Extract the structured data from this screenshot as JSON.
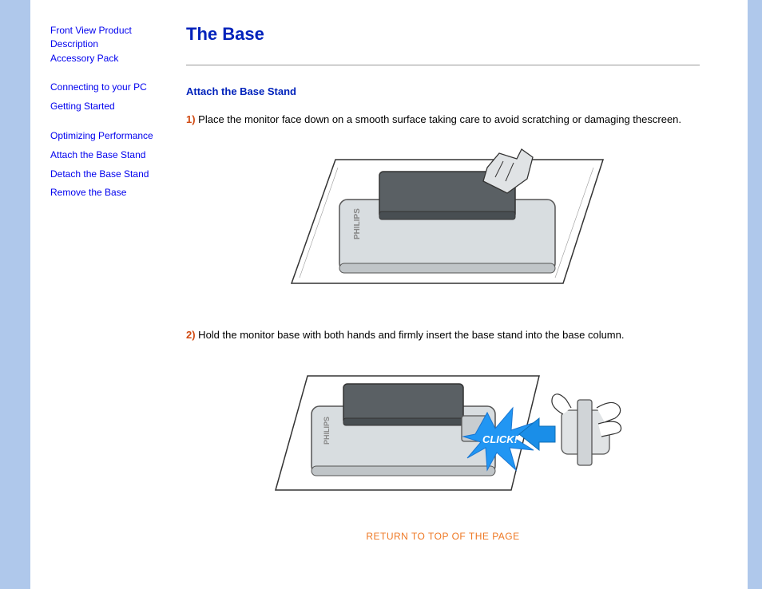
{
  "sidebar": {
    "groups": [
      [
        "Front View Product Description",
        "Accessory Pack"
      ],
      [
        "Connecting to your PC",
        "Getting Started"
      ],
      [
        "Optimizing Performance",
        "Attach the Base Stand",
        "Detach the Base Stand",
        "Remove the Base"
      ]
    ]
  },
  "main": {
    "title": "The Base",
    "section_title": "Attach the Base Stand",
    "steps": [
      {
        "num": "1)",
        "text": " Place the monitor face down on a smooth surface taking care to avoid scratching or damaging thescreen."
      },
      {
        "num": "2)",
        "text": " Hold the monitor base with both hands and firmly insert the base stand into the base column."
      }
    ],
    "click_label": "CLICK!",
    "return_label": "RETURN TO TOP OF THE PAGE",
    "brand_label": "PHILIPS"
  }
}
